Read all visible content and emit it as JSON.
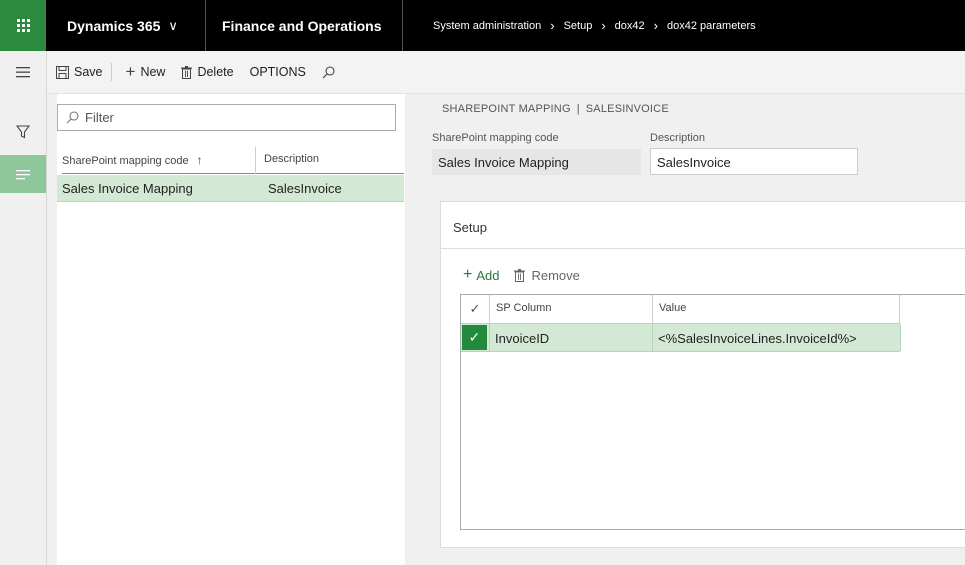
{
  "topbar": {
    "product": "Dynamics 365",
    "app_name": "Finance and Operations",
    "breadcrumbs": [
      "System administration",
      "Setup",
      "dox42",
      "dox42 parameters"
    ]
  },
  "actionpane": {
    "save": "Save",
    "new": "New",
    "delete": "Delete",
    "options": "OPTIONS"
  },
  "list": {
    "filter_placeholder": "Filter",
    "columns": [
      "SharePoint mapping code",
      "Description"
    ],
    "rows": [
      {
        "code": "Sales Invoice Mapping",
        "description": "SalesInvoice"
      }
    ]
  },
  "detail": {
    "caption_left": "SHAREPOINT MAPPING",
    "caption_sep": "|",
    "caption_right": "SALESINVOICE",
    "code_label": "SharePoint mapping code",
    "code_value": "Sales Invoice Mapping",
    "desc_label": "Description",
    "desc_value": "SalesInvoice",
    "setup": {
      "title": "Setup",
      "add": "Add",
      "remove": "Remove",
      "columns": [
        "SP Column",
        "Value"
      ],
      "rows": [
        {
          "sp_column": "InvoiceID",
          "value": "<%SalesInvoiceLines.InvoiceId%>"
        }
      ]
    }
  },
  "colors": {
    "accent": "#2b8a3e",
    "selected_row": "#d3e9d6",
    "topbar": "#000000"
  }
}
